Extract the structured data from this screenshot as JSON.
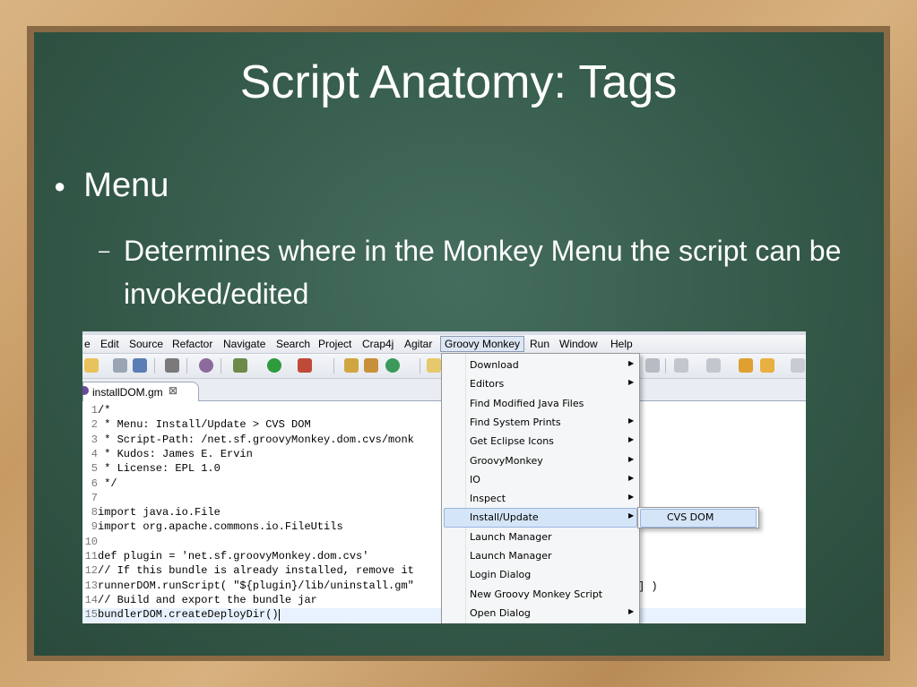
{
  "slide": {
    "title": "Script Anatomy: Tags",
    "bullet": "Menu",
    "sub_bullet": "Determines where in the Monkey Menu the script can be invoked/edited"
  },
  "menubar": [
    "e",
    "Edit",
    "Source",
    "Refactor",
    "Navigate",
    "Search",
    "Project",
    "Crap4j",
    "Agitar",
    "Groovy Monkey",
    "Run",
    "Window",
    "Help"
  ],
  "active_menu": "Groovy Monkey",
  "editor_tab": {
    "label": "installDOM.gm",
    "close": "⊠"
  },
  "code_lines": [
    {
      "n": "1",
      "text": "/*"
    },
    {
      "n": "2",
      "text": " * Menu: Install/Update > CVS DOM"
    },
    {
      "n": "3",
      "text": " * Script-Path: /net.sf.groovyMonkey.dom.cvs/monk"
    },
    {
      "n": "4",
      "text": " * Kudos: James E. Ervin"
    },
    {
      "n": "5",
      "text": " * License: EPL 1.0"
    },
    {
      "n": "6",
      "text": " */"
    },
    {
      "n": "7",
      "text": ""
    },
    {
      "n": "8",
      "text": "import java.io.File"
    },
    {
      "n": "9",
      "text": "import org.apache.commons.io.FileUtils"
    },
    {
      "n": "10",
      "text": ""
    },
    {
      "n": "11",
      "text": "def plugin = 'net.sf.groovyMonkey.dom.cvs'"
    },
    {
      "n": "12",
      "text": "// If this bundle is already installed, remove it"
    },
    {
      "n": "13",
      "text": "runnerDOM.runScript( \"${plugin}/lib/uninstall.gm\""
    },
    {
      "n": "14",
      "text": "// Build and export the bundle jar"
    },
    {
      "n": "15",
      "text": "bundlerDOM.createDeployDir()"
    }
  ],
  "code_trailing": "] )",
  "dropdown_items": [
    {
      "label": "Download",
      "arrow": true
    },
    {
      "label": "Editors",
      "arrow": true
    },
    {
      "label": "Find Modified Java Files",
      "arrow": false
    },
    {
      "label": "Find System Prints",
      "arrow": true
    },
    {
      "label": "Get Eclipse Icons",
      "arrow": true
    },
    {
      "label": "GroovyMonkey",
      "arrow": true
    },
    {
      "label": "IO",
      "arrow": true
    },
    {
      "label": "Inspect",
      "arrow": true
    },
    {
      "label": "Install/Update",
      "arrow": true,
      "highlighted": true
    },
    {
      "label": "Launch Manager",
      "arrow": false
    },
    {
      "label": "Launch Manager",
      "arrow": false
    },
    {
      "label": "Login Dialog",
      "arrow": false
    },
    {
      "label": "New Groovy Monkey Script",
      "arrow": false
    },
    {
      "label": "Open Dialog",
      "arrow": true
    }
  ],
  "submenu_item": "CVS DOM",
  "colors": {
    "board": "#335848",
    "frame": "#c9a06a",
    "menu_highlight": "#d5e5f8"
  }
}
